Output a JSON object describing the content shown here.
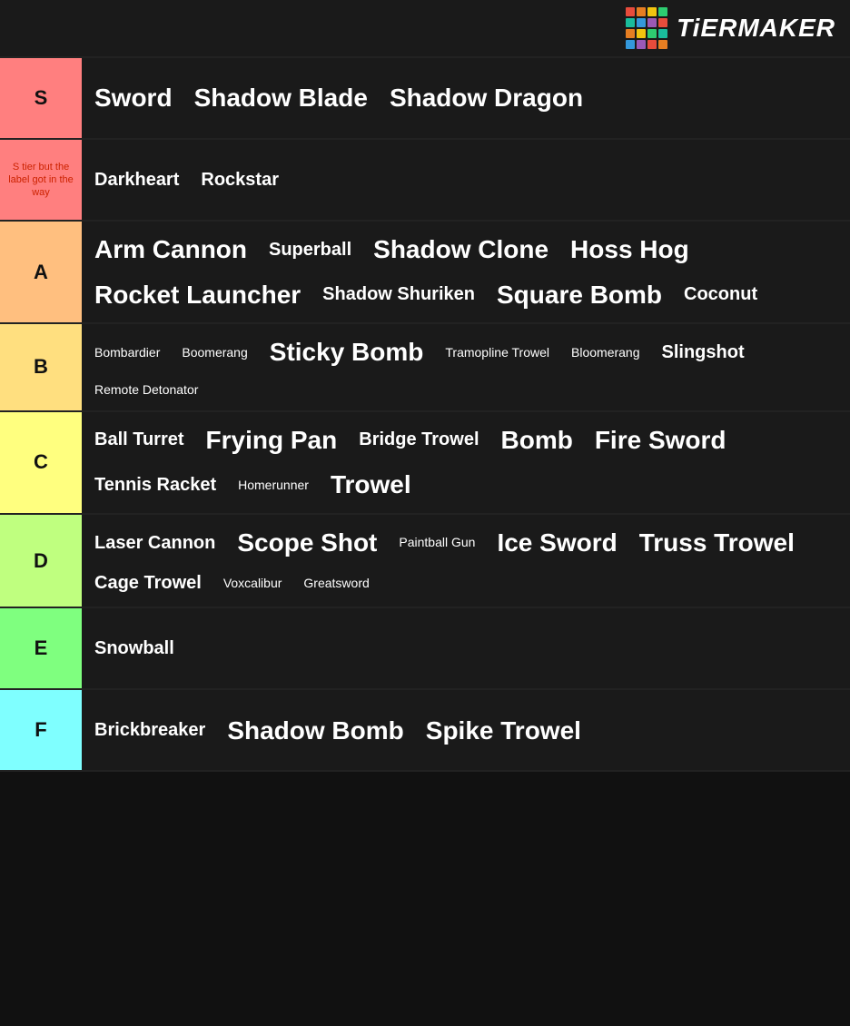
{
  "logo": {
    "text": "TiERMAKER",
    "grid_colors": [
      "#e74c3c",
      "#e67e22",
      "#f1c40f",
      "#2ecc71",
      "#1abc9c",
      "#3498db",
      "#9b59b6",
      "#e74c3c",
      "#e67e22",
      "#f1c40f",
      "#2ecc71",
      "#1abc9c",
      "#3498db",
      "#9b59b6",
      "#e74c3c",
      "#e67e22"
    ]
  },
  "tiers": [
    {
      "id": "s",
      "label": "S",
      "color_class": "s-color",
      "label_style": "normal",
      "items": [
        {
          "text": "Sword",
          "size": "large"
        },
        {
          "text": "Shadow Blade",
          "size": "large"
        },
        {
          "text": "Shadow Dragon",
          "size": "large"
        }
      ]
    },
    {
      "id": "s2",
      "label": "S tier but the label got in the way",
      "color_class": "s2-color",
      "label_style": "small",
      "items": [
        {
          "text": "Darkheart",
          "size": "medium"
        },
        {
          "text": "Rockstar",
          "size": "medium"
        }
      ]
    },
    {
      "id": "a",
      "label": "A",
      "color_class": "a-color",
      "label_style": "normal",
      "items": [
        {
          "text": "Arm Cannon",
          "size": "large"
        },
        {
          "text": "Superball",
          "size": "medium"
        },
        {
          "text": "Shadow Clone",
          "size": "large"
        },
        {
          "text": "Hoss Hog",
          "size": "large"
        },
        {
          "text": "Rocket Launcher",
          "size": "large"
        },
        {
          "text": "Shadow Shuriken",
          "size": "medium"
        },
        {
          "text": "Square Bomb",
          "size": "large"
        },
        {
          "text": "Coconut",
          "size": "medium"
        }
      ]
    },
    {
      "id": "b",
      "label": "B",
      "color_class": "b-color",
      "label_style": "normal",
      "items": [
        {
          "text": "Bombardier",
          "size": "small"
        },
        {
          "text": "Boomerang",
          "size": "small"
        },
        {
          "text": "Sticky Bomb",
          "size": "large"
        },
        {
          "text": "Tramopline Trowel",
          "size": "small"
        },
        {
          "text": "Bloomerang",
          "size": "small"
        },
        {
          "text": "Slingshot",
          "size": "medium"
        },
        {
          "text": "Remote Detonator",
          "size": "small"
        }
      ]
    },
    {
      "id": "c",
      "label": "C",
      "color_class": "c-color",
      "label_style": "normal",
      "items": [
        {
          "text": "Ball Turret",
          "size": "medium"
        },
        {
          "text": "Frying Pan",
          "size": "large"
        },
        {
          "text": "Bridge Trowel",
          "size": "medium"
        },
        {
          "text": "Bomb",
          "size": "large"
        },
        {
          "text": "Fire Sword",
          "size": "large"
        },
        {
          "text": "Tennis Racket",
          "size": "medium"
        },
        {
          "text": "Homerunner",
          "size": "small"
        },
        {
          "text": "Trowel",
          "size": "large"
        }
      ]
    },
    {
      "id": "d",
      "label": "D",
      "color_class": "d-color",
      "label_style": "normal",
      "items": [
        {
          "text": "Laser Cannon",
          "size": "medium"
        },
        {
          "text": "Scope Shot",
          "size": "large"
        },
        {
          "text": "Paintball Gun",
          "size": "small"
        },
        {
          "text": "Ice Sword",
          "size": "large"
        },
        {
          "text": "Truss Trowel",
          "size": "large"
        },
        {
          "text": "Cage Trowel",
          "size": "medium"
        },
        {
          "text": "Voxcalibur",
          "size": "small"
        },
        {
          "text": "Greatsword",
          "size": "small"
        }
      ]
    },
    {
      "id": "e",
      "label": "E",
      "color_class": "e-color",
      "label_style": "normal",
      "items": [
        {
          "text": "Snowball",
          "size": "medium"
        }
      ]
    },
    {
      "id": "f",
      "label": "F",
      "color_class": "f-color",
      "label_style": "normal",
      "items": [
        {
          "text": "Brickbreaker",
          "size": "medium"
        },
        {
          "text": "Shadow Bomb",
          "size": "large"
        },
        {
          "text": "Spike Trowel",
          "size": "large"
        }
      ]
    }
  ]
}
